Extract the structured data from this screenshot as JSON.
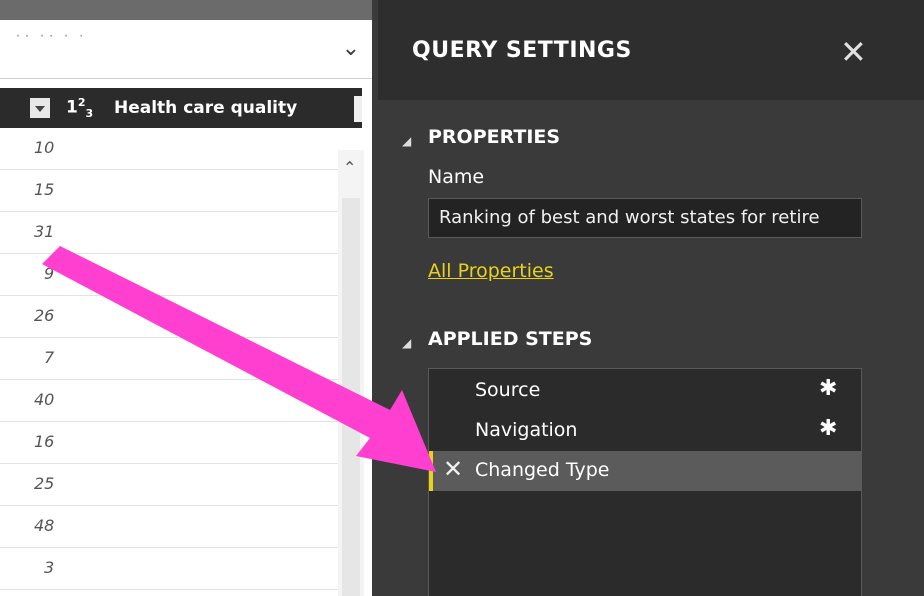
{
  "formula_bar": {
    "text": "˙˙ ˙˙ ˙ ˙",
    "chevron": "chevron-down-icon"
  },
  "grid": {
    "column": {
      "type_prefix": "1",
      "type_sup": "2",
      "type_sub": "3",
      "title": "Health care quality"
    },
    "rows": [
      "10",
      "15",
      "31",
      "9",
      "26",
      "7",
      "40",
      "16",
      "25",
      "48",
      "3"
    ]
  },
  "panel": {
    "title": "QUERY SETTINGS",
    "close_glyph": "✕",
    "properties": {
      "heading": "PROPERTIES",
      "name_label": "Name",
      "name_value": "Ranking of best and worst states for retire",
      "all_properties_link": "All Properties"
    },
    "applied_steps": {
      "heading": "APPLIED STEPS",
      "steps": [
        {
          "label": "Source",
          "has_settings": true
        },
        {
          "label": "Navigation",
          "has_settings": true
        },
        {
          "label": "Changed Type",
          "has_settings": false,
          "selected": true
        }
      ]
    }
  },
  "colors": {
    "panel_bg": "#3a3a3a",
    "header_bg": "#2e2e2e",
    "link_yellow": "#e8d21a",
    "annotation_arrow": "#ff3fd0"
  },
  "glyphs": {
    "caret": "◢",
    "gear": "✱",
    "delete": "✕",
    "scroll_up": "⌃"
  }
}
